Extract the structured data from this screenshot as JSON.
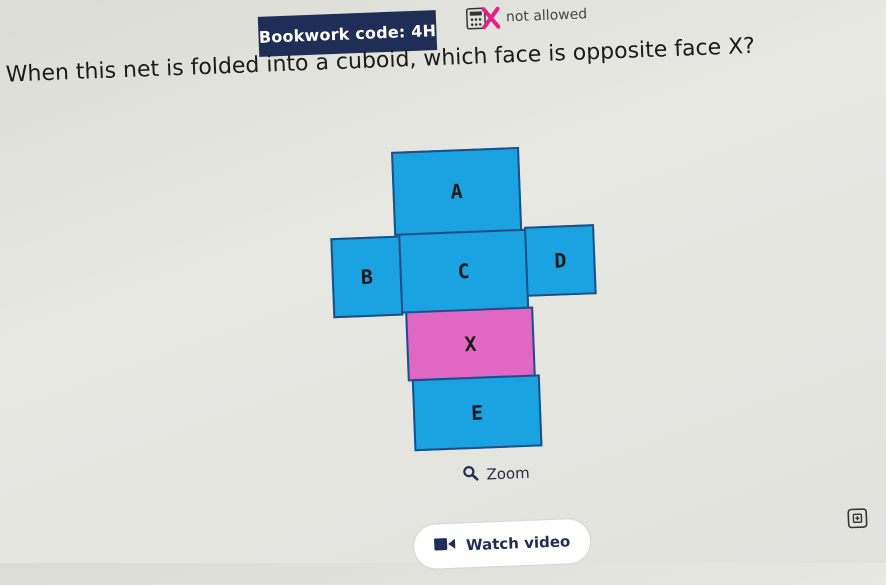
{
  "header": {
    "bookwork_code": "Bookwork code: 4H",
    "calculator_status": "not allowed",
    "calculator_icon": "calculator-crossed-icon"
  },
  "question": {
    "text": "When this net is folded into a cuboid, which face is opposite face X?"
  },
  "net": {
    "faces": {
      "a": "A",
      "b": "B",
      "c": "C",
      "d": "D",
      "x": "X",
      "e": "E"
    },
    "colors": {
      "face": "#1aa3e0",
      "highlight": "#e067c4",
      "border": "#1c4f8a"
    }
  },
  "controls": {
    "zoom_label": "Zoom",
    "zoom_icon": "magnifier-icon",
    "watch_video_label": "Watch video",
    "watch_video_icon": "video-camera-icon"
  },
  "colors": {
    "navy": "#1f2e57",
    "background": "#e4e4df"
  }
}
